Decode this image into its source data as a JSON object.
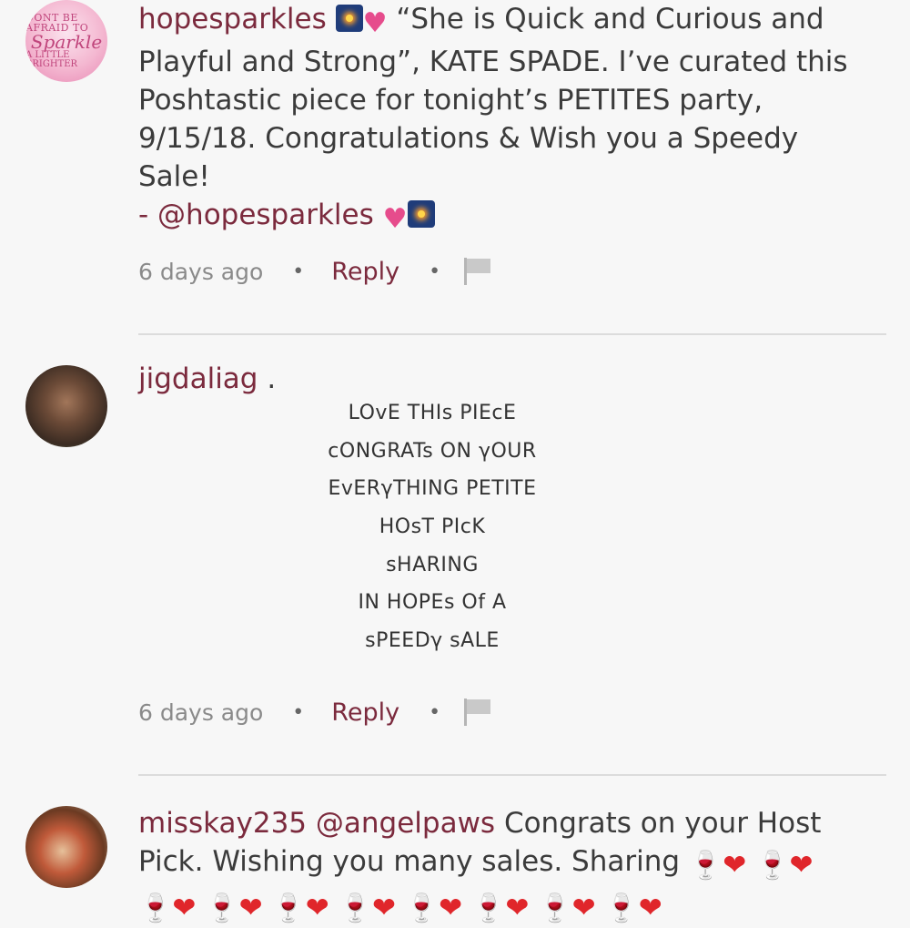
{
  "comments": [
    {
      "username": "hopesparkles",
      "avatar": {
        "line1": "DONT BE AFRAID TO",
        "line2": "Sparkle",
        "line3": "A LITTLE BRIGHTER"
      },
      "text": "“She is Quick and Curious and Playful and Strong”, KATE SPADE. I’ve curated this Poshtastic piece for tonight’s PETITES party, 9/15/18. Congratulations & Wish you a Speedy Sale!",
      "signoff": "- @hopesparkles",
      "time": "6 days ago",
      "reply_label": "Reply"
    },
    {
      "username": "jigdaliag",
      "username_suffix": ".",
      "lines": [
        "LOvE THIs PIEcE",
        "cONGRATs ON γOUR",
        "EvERγTHING PETITE",
        "HOsT PIcK",
        "sHARING",
        "IN HOPEs Of A",
        "sPEEDγ sALE"
      ],
      "time": "6 days ago",
      "reply_label": "Reply"
    },
    {
      "username": "misskay235",
      "mention": "@angelpaws",
      "text": "Congrats on your Host Pick. Wishing you many sales. Sharing"
    }
  ],
  "icons": {
    "sparkle_square": "fireworks-emoji",
    "sparkle_heart": "sparkling-heart-emoji",
    "wine": "wine-glass-emoji",
    "heart": "red-heart-emoji",
    "flag": "flag-icon"
  },
  "colors": {
    "username": "#7b2a3d",
    "reply": "#7b2a3d",
    "meta": "#8a8a8a"
  }
}
